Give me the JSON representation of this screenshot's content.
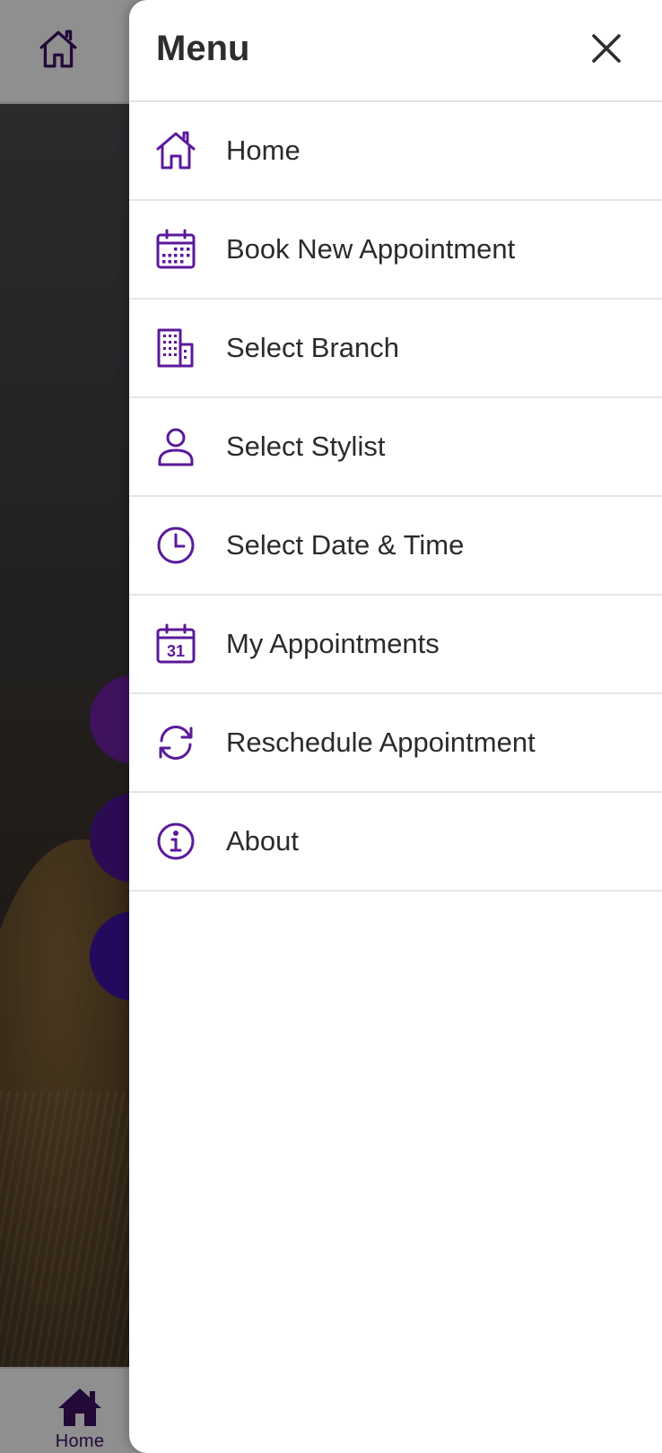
{
  "drawer": {
    "title": "Menu",
    "items": [
      {
        "label": "Home",
        "icon": "home-icon"
      },
      {
        "label": "Book New Appointment",
        "icon": "calendar-grid-icon"
      },
      {
        "label": "Select Branch",
        "icon": "building-icon"
      },
      {
        "label": "Select Stylist",
        "icon": "person-icon"
      },
      {
        "label": "Select Date & Time",
        "icon": "clock-icon"
      },
      {
        "label": "My Appointments",
        "icon": "calendar-31-icon"
      },
      {
        "label": "Reschedule Appointment",
        "icon": "refresh-icon"
      },
      {
        "label": "About",
        "icon": "info-icon"
      }
    ]
  },
  "calendar_icon_number": "31",
  "tabbar": {
    "home_label": "Home"
  },
  "colors": {
    "accent": "#5b1a9a",
    "text": "#2b2b2b",
    "tab_icon": "#3b1060"
  }
}
